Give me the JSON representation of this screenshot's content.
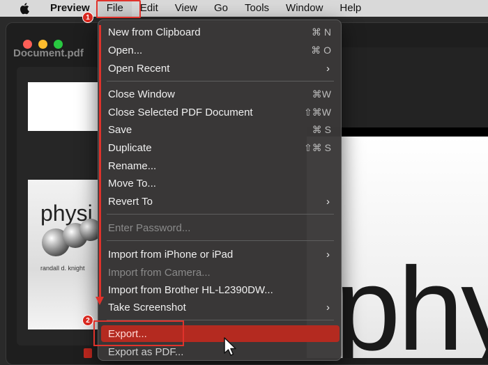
{
  "menubar": {
    "app": "Preview",
    "items": [
      "File",
      "Edit",
      "View",
      "Go",
      "Tools",
      "Window",
      "Help"
    ]
  },
  "window": {
    "title": "Document.pdf"
  },
  "thumbnail": {
    "title_word": "physi",
    "author": "randall d. knight"
  },
  "page": {
    "big_word": "phy"
  },
  "steps": [
    "1",
    "2"
  ],
  "file_menu": {
    "new_from_clipboard": {
      "label": "New from Clipboard",
      "shortcut": "⌘ N"
    },
    "open": {
      "label": "Open...",
      "shortcut": "⌘ O"
    },
    "open_recent": {
      "label": "Open Recent"
    },
    "close_window": {
      "label": "Close Window",
      "shortcut": "⌘W"
    },
    "close_selected": {
      "label": "Close Selected PDF Document",
      "shortcut": "⇧⌘W"
    },
    "save": {
      "label": "Save",
      "shortcut": "⌘ S"
    },
    "duplicate": {
      "label": "Duplicate",
      "shortcut": "⇧⌘ S"
    },
    "rename": {
      "label": "Rename..."
    },
    "move_to": {
      "label": "Move To..."
    },
    "revert_to": {
      "label": "Revert To"
    },
    "enter_password": {
      "label": "Enter Password..."
    },
    "import_iphone": {
      "label": "Import from iPhone or iPad"
    },
    "import_camera": {
      "label": "Import from Camera..."
    },
    "import_brother": {
      "label": "Import from Brother HL-L2390DW..."
    },
    "take_screenshot": {
      "label": "Take Screenshot"
    },
    "export": {
      "label": "Export..."
    },
    "export_pdf": {
      "label": "Export as PDF..."
    }
  },
  "colors": {
    "highlight": "#b42a20",
    "annotation": "#e0322b"
  }
}
